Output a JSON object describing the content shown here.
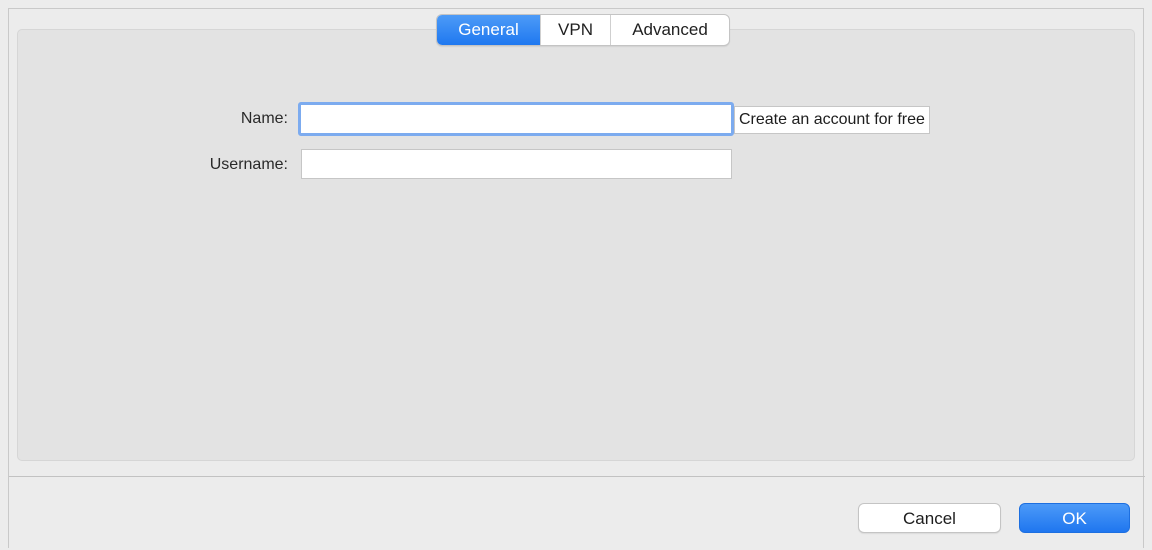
{
  "tabs": [
    {
      "label": "General",
      "active": true
    },
    {
      "label": "VPN",
      "active": false
    },
    {
      "label": "Advanced",
      "active": false
    }
  ],
  "form": {
    "name_label": "Name:",
    "name_value": "",
    "username_label": "Username:",
    "username_value": "",
    "create_account_label": "Create an account for free"
  },
  "buttons": {
    "cancel_label": "Cancel",
    "ok_label": "OK"
  },
  "colors": {
    "accent": "#1f78f0",
    "focus_ring": "#7cabef",
    "window_bg": "#ececec"
  }
}
